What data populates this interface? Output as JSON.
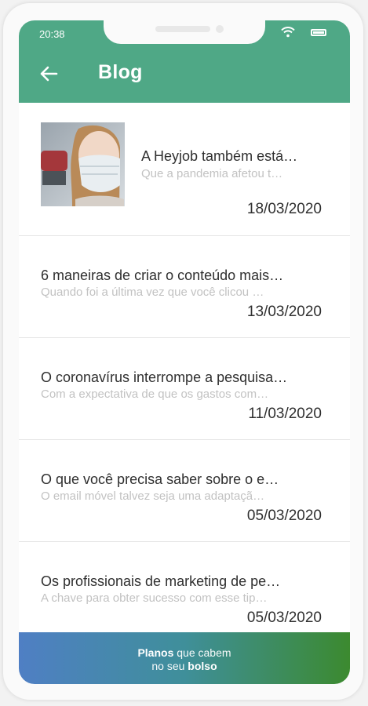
{
  "status_bar": {
    "time": "20:38"
  },
  "header": {
    "title": "Blog"
  },
  "posts": [
    {
      "title": "A Heyjob também está…",
      "excerpt": "Que a pandemia afetou t…",
      "date": "18/03/2020"
    },
    {
      "title": "6 maneiras de criar o conteúdo mais…",
      "excerpt": "Quando foi a última vez que você clicou …",
      "date": "13/03/2020"
    },
    {
      "title": "O coronavírus interrompe a pesquisa…",
      "excerpt": "Com a expectativa de que os gastos com…",
      "date": "11/03/2020"
    },
    {
      "title": "O que você precisa saber sobre o e…",
      "excerpt": "O email móvel talvez seja uma adaptaçã…",
      "date": "05/03/2020"
    },
    {
      "title": "Os profissionais de marketing de pe…",
      "excerpt": "A chave para obter sucesso com esse tip…",
      "date": "05/03/2020"
    }
  ],
  "banner": {
    "l1_bold": "Planos",
    "l1_rest": "que cabem",
    "l2_rest": "no seu",
    "l2_bold": "bolso"
  },
  "colors": {
    "primary": "#4fa886",
    "banner_left": "#4f7fc4",
    "banner_right": "#3c8a2f"
  },
  "icons": {
    "back": "arrow-left-icon",
    "wifi": "wifi-icon",
    "battery": "battery-icon"
  }
}
